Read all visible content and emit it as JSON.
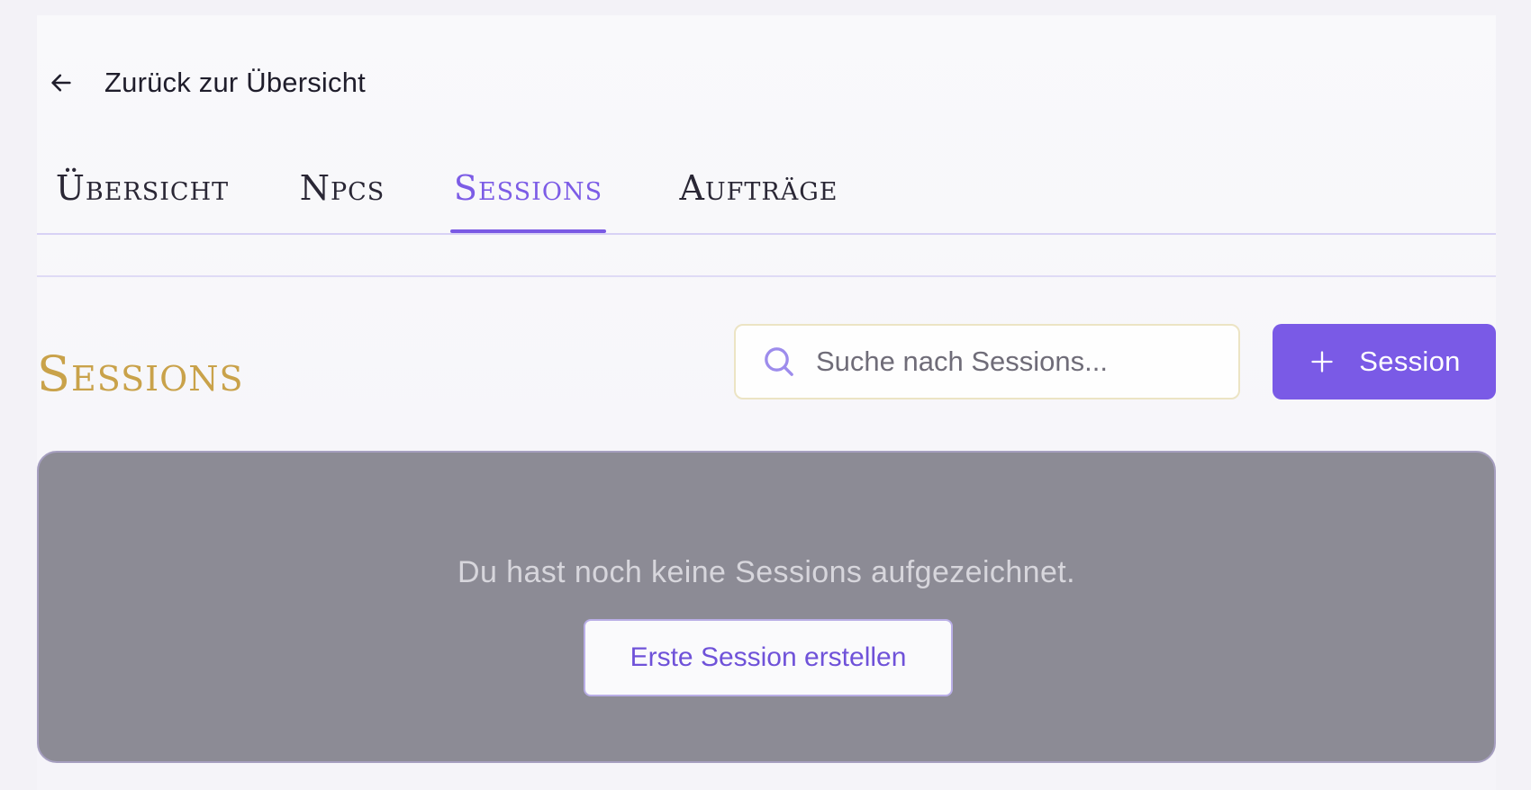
{
  "back_link": {
    "label": "Zurück zur Übersicht",
    "icon": "arrow-left-icon"
  },
  "tabs": [
    {
      "label": "Übersicht",
      "active": false
    },
    {
      "label": "Npcs",
      "active": false
    },
    {
      "label": "Sessions",
      "active": true
    },
    {
      "label": "Aufträge",
      "active": false
    }
  ],
  "section": {
    "title": "Sessions"
  },
  "search": {
    "placeholder": "Suche nach Sessions...",
    "value": "",
    "icon": "search-icon"
  },
  "add_button": {
    "label": "Session",
    "icon": "plus-icon"
  },
  "empty_state": {
    "message": "Du hast noch keine Sessions aufgezeichnet.",
    "button_label": "Erste Session erstellen"
  },
  "colors": {
    "accent": "#7a5ae6",
    "title_gold": "#c9a24a",
    "empty_bg": "#8c8b95"
  }
}
